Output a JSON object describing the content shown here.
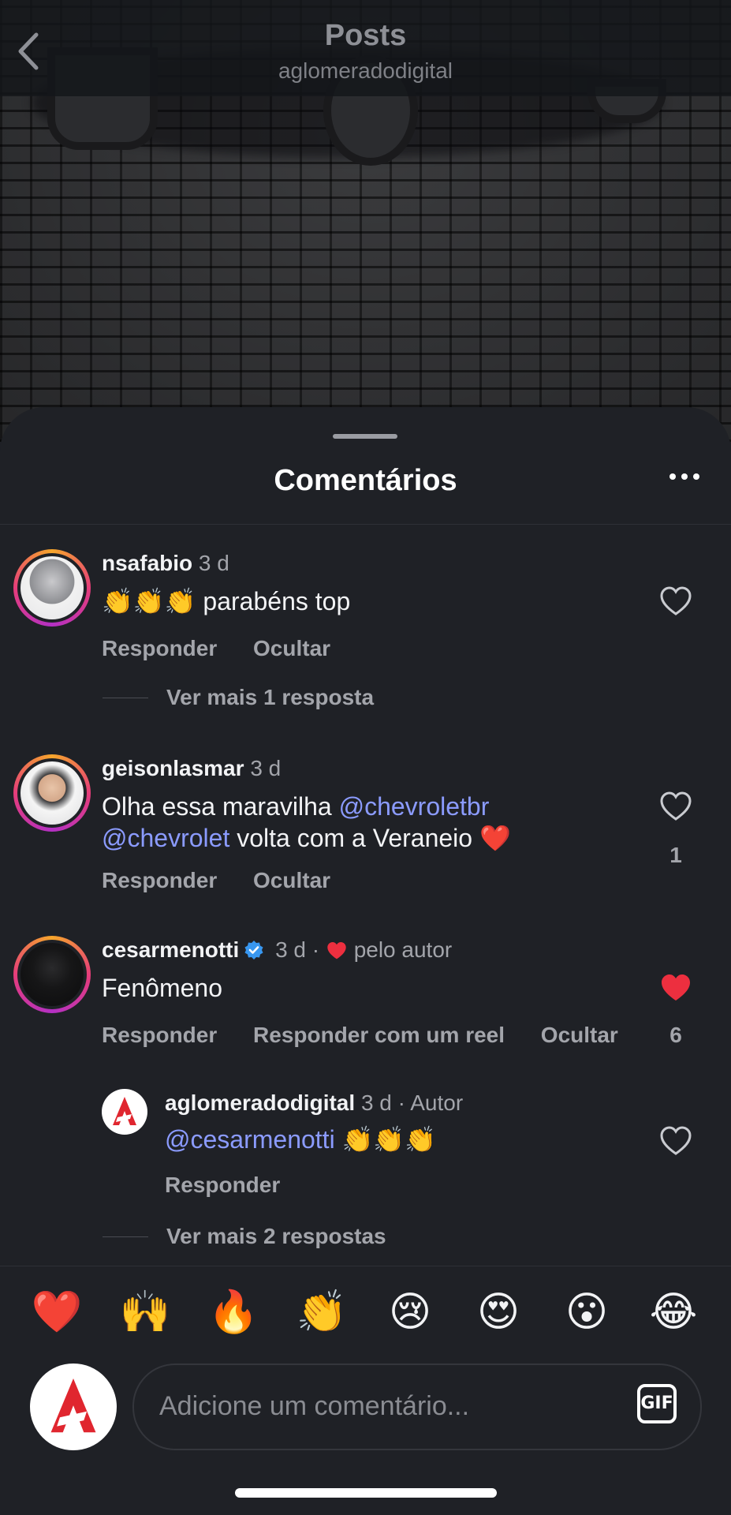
{
  "nav": {
    "title": "Posts",
    "subtitle": "aglomeradodigital"
  },
  "sheet": {
    "title": "Comentários"
  },
  "comments": [
    {
      "username": "nsafabio",
      "time": "3 d",
      "emojis": "👏👏👏",
      "text": "parabéns top",
      "reply_label": "Responder",
      "hide_label": "Ocultar",
      "view_more": "Ver mais 1 resposta"
    },
    {
      "username": "geisonlasmar",
      "time": "3 d",
      "text_part1": "Olha essa maravilha ",
      "mention1": "@chevroletbr",
      "mention2": "@chevrolet",
      "text_part2": " volta com a Veraneio ",
      "emoji": "❤️",
      "reply_label": "Responder",
      "hide_label": "Ocultar",
      "likes": "1"
    },
    {
      "username": "cesarmenotti",
      "time": "3 d",
      "separator": "·",
      "liked_by": "pelo autor",
      "text": "Fenômeno",
      "reply_label": "Responder",
      "reel_label": "Responder com um reel",
      "hide_label": "Ocultar",
      "likes": "6",
      "reply": {
        "username": "aglomeradodigital",
        "time": "3 d",
        "badge": "· Autor",
        "mention": "@cesarmenotti",
        "emojis": "👏👏👏",
        "reply_label": "Responder"
      },
      "view_more": "Ver mais 2 respostas"
    }
  ],
  "emoji_bar": [
    "❤️",
    "🙌",
    "🔥",
    "👏",
    "😢",
    "😍",
    "😮",
    "😂"
  ],
  "composer": {
    "placeholder": "Adicione um comentário...",
    "gif_label": "GIF"
  },
  "colors": {
    "background": "#1f2126",
    "mention": "#8b9bff",
    "like": "#ed2f3f",
    "verified": "#3897f0"
  }
}
